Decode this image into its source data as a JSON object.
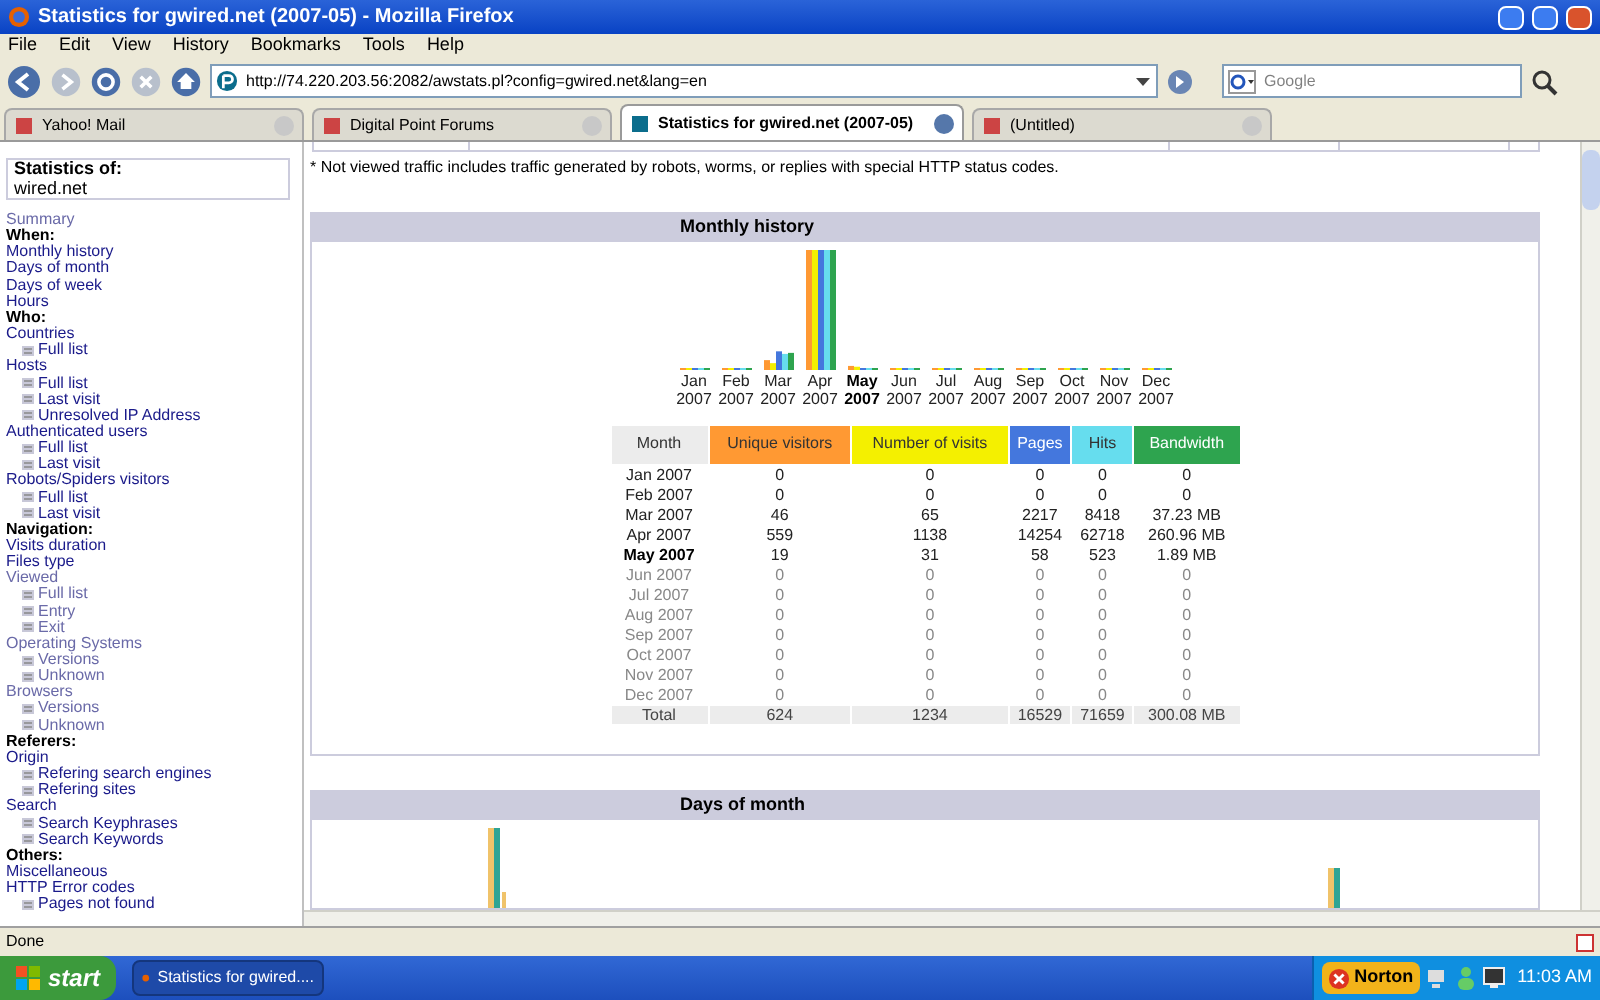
{
  "window": {
    "title": "Statistics for gwired.net (2007-05) - Mozilla Firefox"
  },
  "menu": [
    "File",
    "Edit",
    "View",
    "History",
    "Bookmarks",
    "Tools",
    "Help"
  ],
  "address_bar": {
    "value": "http://74.220.203.56:2082/awstats.pl?config=gwired.net&lang=en"
  },
  "search": {
    "placeholder": "Google"
  },
  "tabs": [
    {
      "label": "Yahoo! Mail",
      "selected": false
    },
    {
      "label": "Digital Point Forums",
      "selected": false
    },
    {
      "label": "Statistics for gwired.net (2007-05)",
      "selected": true
    },
    {
      "label": "(Untitled)",
      "selected": false
    }
  ],
  "sidebar": {
    "box_title": "Statistics of:",
    "site": "wired.net",
    "items": [
      {
        "kind": "link",
        "label": "Summary",
        "visited": true
      },
      {
        "kind": "heading",
        "label": "When:"
      },
      {
        "kind": "link",
        "label": "Monthly history",
        "visited": false
      },
      {
        "kind": "link",
        "label": "Days of month",
        "visited": false
      },
      {
        "kind": "link",
        "label": "Days of week",
        "visited": false
      },
      {
        "kind": "link",
        "label": "Hours",
        "visited": false
      },
      {
        "kind": "heading",
        "label": "Who:"
      },
      {
        "kind": "link",
        "label": "Countries",
        "visited": false
      },
      {
        "kind": "sublink",
        "label": "Full list",
        "visited": false
      },
      {
        "kind": "link",
        "label": "Hosts",
        "visited": false
      },
      {
        "kind": "sublink",
        "label": "Full list",
        "visited": false
      },
      {
        "kind": "sublink",
        "label": "Last visit",
        "visited": false
      },
      {
        "kind": "sublink",
        "label": "Unresolved IP Address",
        "visited": false
      },
      {
        "kind": "link",
        "label": "Authenticated users",
        "visited": false
      },
      {
        "kind": "sublink",
        "label": "Full list",
        "visited": false
      },
      {
        "kind": "sublink",
        "label": "Last visit",
        "visited": false
      },
      {
        "kind": "link",
        "label": "Robots/Spiders visitors",
        "visited": false
      },
      {
        "kind": "sublink",
        "label": "Full list",
        "visited": false
      },
      {
        "kind": "sublink",
        "label": "Last visit",
        "visited": false
      },
      {
        "kind": "heading",
        "label": "Navigation:"
      },
      {
        "kind": "link",
        "label": "Visits duration",
        "visited": false
      },
      {
        "kind": "link",
        "label": "Files type",
        "visited": false
      },
      {
        "kind": "link",
        "label": "Viewed",
        "visited": true
      },
      {
        "kind": "sublink",
        "label": "Full list",
        "visited": true
      },
      {
        "kind": "sublink",
        "label": "Entry",
        "visited": true
      },
      {
        "kind": "sublink",
        "label": "Exit",
        "visited": true
      },
      {
        "kind": "link",
        "label": "Operating Systems",
        "visited": true
      },
      {
        "kind": "sublink",
        "label": "Versions",
        "visited": true
      },
      {
        "kind": "sublink",
        "label": "Unknown",
        "visited": true
      },
      {
        "kind": "link",
        "label": "Browsers",
        "visited": true
      },
      {
        "kind": "sublink",
        "label": "Versions",
        "visited": true
      },
      {
        "kind": "sublink",
        "label": "Unknown",
        "visited": true
      },
      {
        "kind": "heading",
        "label": "Referers:"
      },
      {
        "kind": "link",
        "label": "Origin",
        "visited": false
      },
      {
        "kind": "sublink",
        "label": "Refering search engines",
        "visited": false
      },
      {
        "kind": "sublink",
        "label": "Refering sites",
        "visited": false
      },
      {
        "kind": "link",
        "label": "Search",
        "visited": false
      },
      {
        "kind": "sublink",
        "label": "Search Keyphrases",
        "visited": false
      },
      {
        "kind": "sublink",
        "label": "Search Keywords",
        "visited": false
      },
      {
        "kind": "heading",
        "label": "Others:"
      },
      {
        "kind": "link",
        "label": "Miscellaneous",
        "visited": false
      },
      {
        "kind": "link",
        "label": "HTTP Error codes",
        "visited": false
      },
      {
        "kind": "sublink",
        "label": "Pages not found",
        "visited": false
      }
    ]
  },
  "footnote": "* Not viewed traffic includes traffic generated by robots, worms, or replies with special HTTP status codes.",
  "monthly_history": {
    "title": "Monthly history",
    "chart_labels": [
      {
        "month": "Jan",
        "year": "2007",
        "current": false
      },
      {
        "month": "Feb",
        "year": "2007",
        "current": false
      },
      {
        "month": "Mar",
        "year": "2007",
        "current": false
      },
      {
        "month": "Apr",
        "year": "2007",
        "current": false
      },
      {
        "month": "May",
        "year": "2007",
        "current": true
      },
      {
        "month": "Jun",
        "year": "2007",
        "current": false
      },
      {
        "month": "Jul",
        "year": "2007",
        "current": false
      },
      {
        "month": "Aug",
        "year": "2007",
        "current": false
      },
      {
        "month": "Sep",
        "year": "2007",
        "current": false
      },
      {
        "month": "Oct",
        "year": "2007",
        "current": false
      },
      {
        "month": "Nov",
        "year": "2007",
        "current": false
      },
      {
        "month": "Dec",
        "year": "2007",
        "current": false
      }
    ],
    "columns": [
      {
        "label": "Month",
        "color": "#ececec"
      },
      {
        "label": "Unique visitors",
        "color": "#ff9933"
      },
      {
        "label": "Number of visits",
        "color": "#f4f000"
      },
      {
        "label": "Pages",
        "color": "#4477dd"
      },
      {
        "label": "Hits",
        "color": "#66ddee"
      },
      {
        "label": "Bandwidth",
        "color": "#2ea44f"
      }
    ],
    "rows": [
      {
        "current": false,
        "future": false,
        "cells": [
          "Jan 2007",
          "0",
          "0",
          "0",
          "0",
          "0"
        ]
      },
      {
        "current": false,
        "future": false,
        "cells": [
          "Feb 2007",
          "0",
          "0",
          "0",
          "0",
          "0"
        ]
      },
      {
        "current": false,
        "future": false,
        "cells": [
          "Mar 2007",
          "46",
          "65",
          "2217",
          "8418",
          "37.23 MB"
        ]
      },
      {
        "current": false,
        "future": false,
        "cells": [
          "Apr 2007",
          "559",
          "1138",
          "14254",
          "62718",
          "260.96 MB"
        ]
      },
      {
        "current": true,
        "future": false,
        "cells": [
          "May 2007",
          "19",
          "31",
          "58",
          "523",
          "1.89 MB"
        ]
      },
      {
        "current": false,
        "future": true,
        "cells": [
          "Jun 2007",
          "0",
          "0",
          "0",
          "0",
          "0"
        ]
      },
      {
        "current": false,
        "future": true,
        "cells": [
          "Jul 2007",
          "0",
          "0",
          "0",
          "0",
          "0"
        ]
      },
      {
        "current": false,
        "future": true,
        "cells": [
          "Aug 2007",
          "0",
          "0",
          "0",
          "0",
          "0"
        ]
      },
      {
        "current": false,
        "future": true,
        "cells": [
          "Sep 2007",
          "0",
          "0",
          "0",
          "0",
          "0"
        ]
      },
      {
        "current": false,
        "future": true,
        "cells": [
          "Oct 2007",
          "0",
          "0",
          "0",
          "0",
          "0"
        ]
      },
      {
        "current": false,
        "future": true,
        "cells": [
          "Nov 2007",
          "0",
          "0",
          "0",
          "0",
          "0"
        ]
      },
      {
        "current": false,
        "future": true,
        "cells": [
          "Dec 2007",
          "0",
          "0",
          "0",
          "0",
          "0"
        ]
      }
    ],
    "total": [
      "Total",
      "624",
      "1234",
      "16529",
      "71659",
      "300.08 MB"
    ]
  },
  "days_of_month": {
    "title": "Days of month"
  },
  "status_bar": {
    "text": "Done"
  },
  "taskbar": {
    "start": "start",
    "buttons": [
      {
        "label": "Statistics for gwired....",
        "selected": true
      }
    ],
    "norton": "Norton",
    "clock": "11:03 AM"
  }
}
